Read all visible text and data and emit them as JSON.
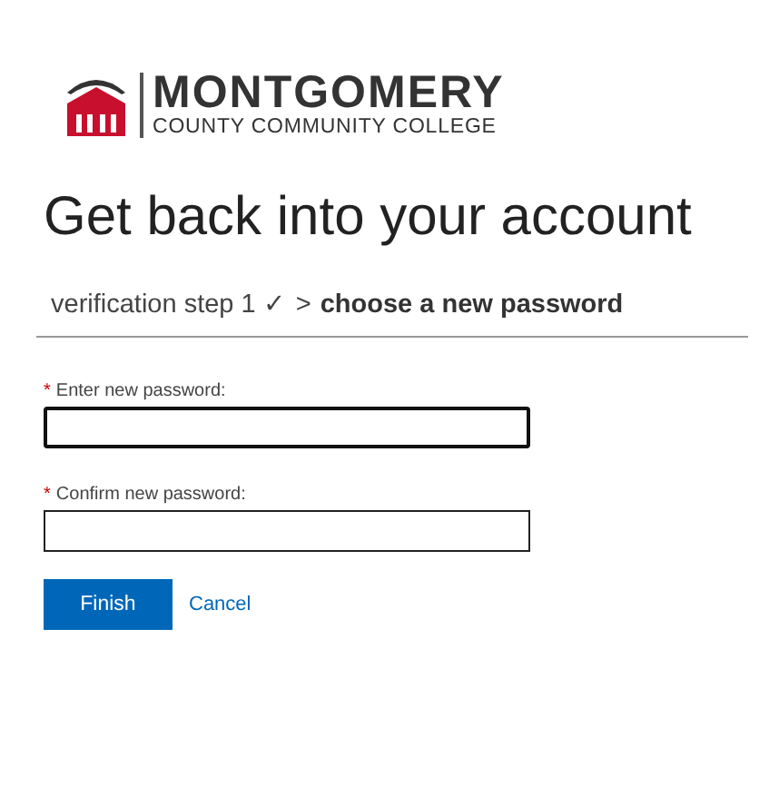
{
  "logo": {
    "name": "MONTGOMERY",
    "subtitle": "COUNTY COMMUNITY COLLEGE"
  },
  "title": "Get back into your account",
  "breadcrumb": {
    "done_step": "verification step 1 ✓",
    "separator": ">",
    "current_step": "choose a new password"
  },
  "fields": [
    {
      "required_mark": "*",
      "label": "Enter new password:",
      "focused": true
    },
    {
      "required_mark": "*",
      "label": "Confirm new password:",
      "focused": false
    }
  ],
  "buttons": [
    {
      "kind": "primary",
      "label": "Finish"
    },
    {
      "kind": "link",
      "label": "Cancel"
    }
  ]
}
